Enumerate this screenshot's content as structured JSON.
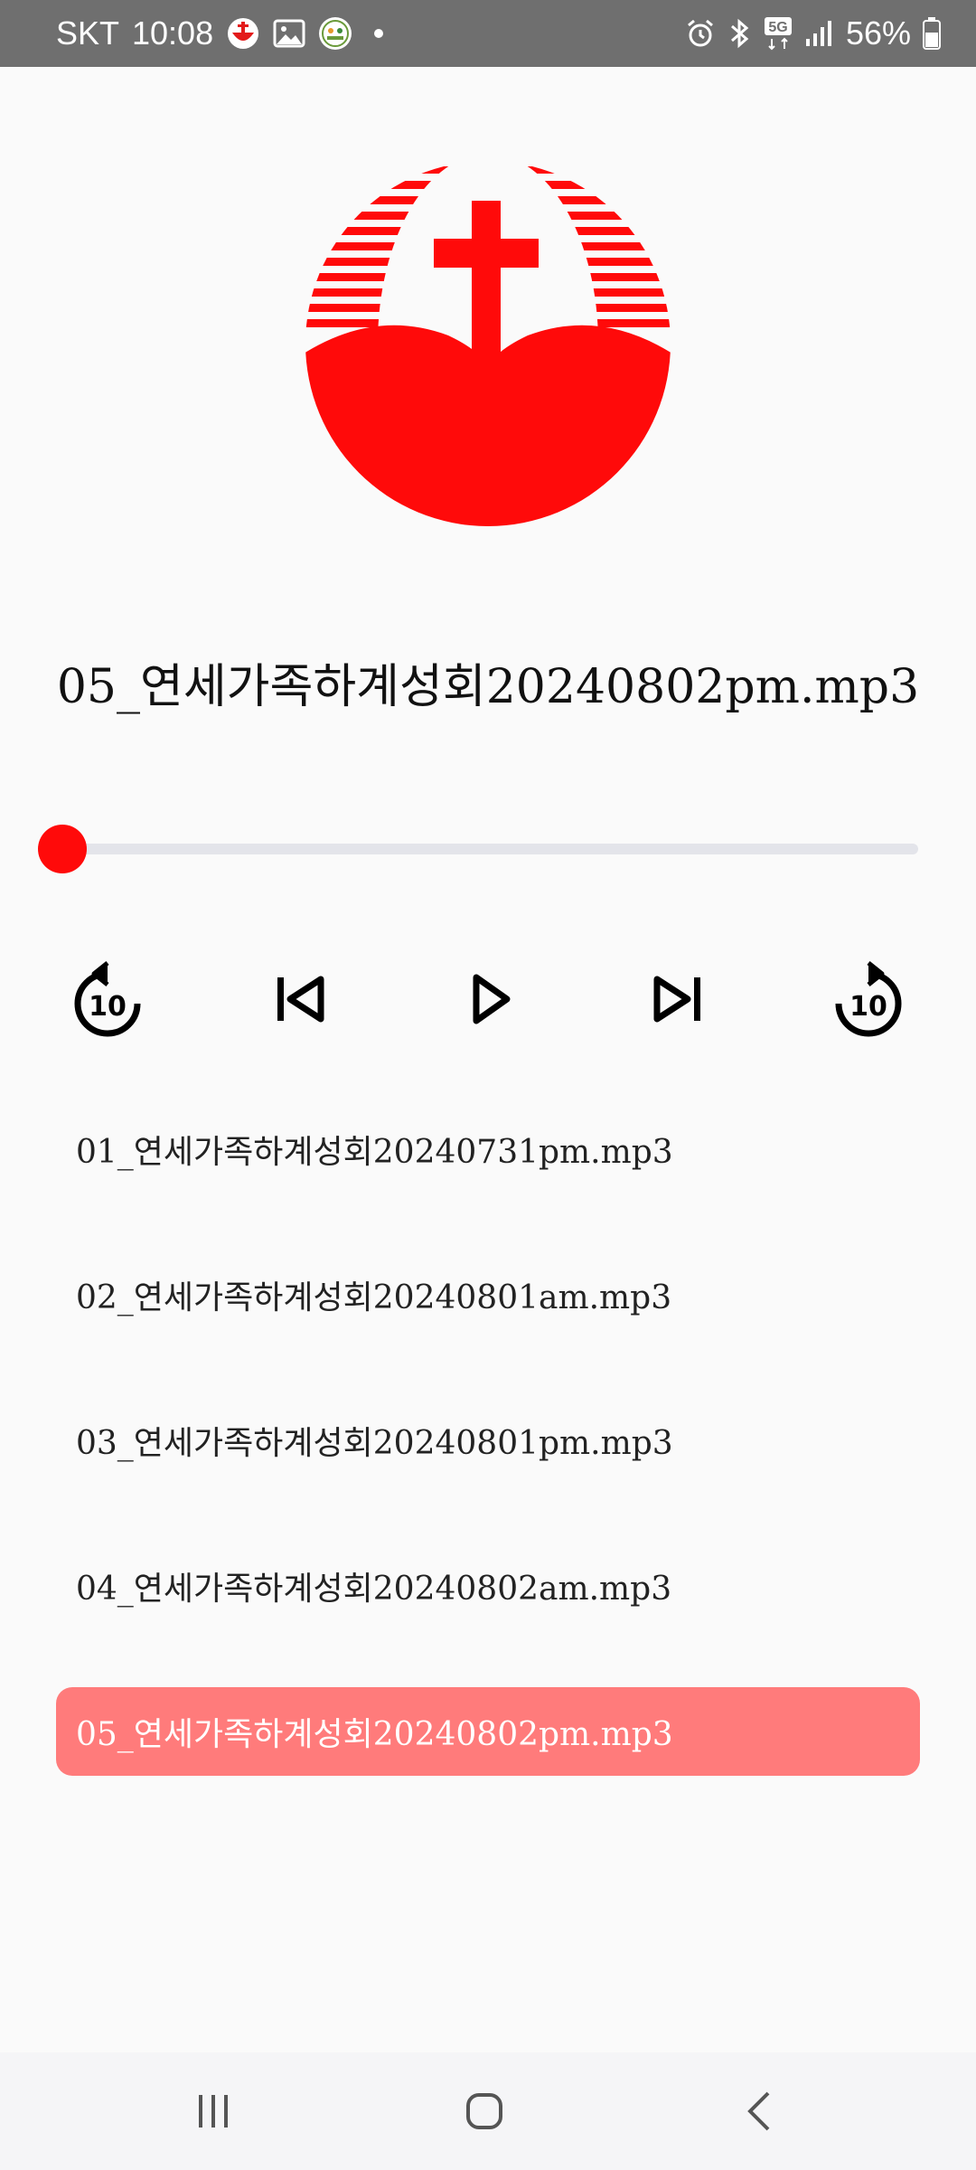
{
  "status_bar": {
    "carrier": "SKT",
    "time": "10:08",
    "network": "5G",
    "battery": "56%"
  },
  "player": {
    "now_playing": "05_연세가족하계성회20240802pm.mp3",
    "progress": 0.0
  },
  "playlist": [
    {
      "title": "01_연세가족하계성회20240731pm.mp3",
      "active": false
    },
    {
      "title": "02_연세가족하계성회20240801am.mp3",
      "active": false
    },
    {
      "title": "03_연세가족하계성회20240801pm.mp3",
      "active": false
    },
    {
      "title": "04_연세가족하계성회20240802am.mp3",
      "active": false
    },
    {
      "title": "05_연세가족하계성회20240802pm.mp3",
      "active": true
    }
  ],
  "controls": {
    "rewind_seconds": "10",
    "forward_seconds": "10"
  },
  "colors": {
    "accent": "#ff0a0a",
    "active_row": "#ff7b7b",
    "track": "#e3e4ea",
    "status_bar": "#6f6f6f"
  }
}
